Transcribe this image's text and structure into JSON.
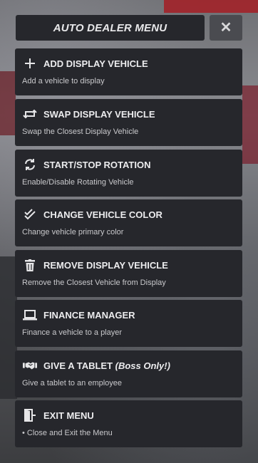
{
  "header": {
    "title": "AUTO DEALER MENU",
    "close_label": "✕"
  },
  "items": [
    {
      "icon": "plus-icon",
      "title": "ADD DISPLAY VEHICLE",
      "title_suffix": "",
      "subtitle": "Add a vehicle to display"
    },
    {
      "icon": "swap-icon",
      "title": "SWAP DISPLAY VEHICLE",
      "title_suffix": "",
      "subtitle": "Swap the Closest Display Vehicle"
    },
    {
      "icon": "refresh-icon",
      "title": "START/STOP ROTATION",
      "title_suffix": "",
      "subtitle": "Enable/Disable Rotating Vehicle"
    },
    {
      "icon": "double-check-icon",
      "title": "CHANGE VEHICLE COLOR",
      "title_suffix": "",
      "subtitle": "Change vehicle primary color"
    },
    {
      "icon": "trash-icon",
      "title": "REMOVE DISPLAY VEHICLE",
      "title_suffix": "",
      "subtitle": "Remove the Closest Vehicle from Display"
    },
    {
      "icon": "laptop-icon",
      "title": "FINANCE MANAGER",
      "title_suffix": "",
      "subtitle": "Finance a vehicle to a player"
    },
    {
      "icon": "handshake-icon",
      "title": "GIVE A TABLET ",
      "title_suffix": "(Boss Only!)",
      "subtitle": "Give a tablet to an employee"
    },
    {
      "icon": "door-exit-icon",
      "title": "EXIT MENU",
      "title_suffix": "",
      "subtitle": "• Close and Exit the Menu"
    }
  ]
}
